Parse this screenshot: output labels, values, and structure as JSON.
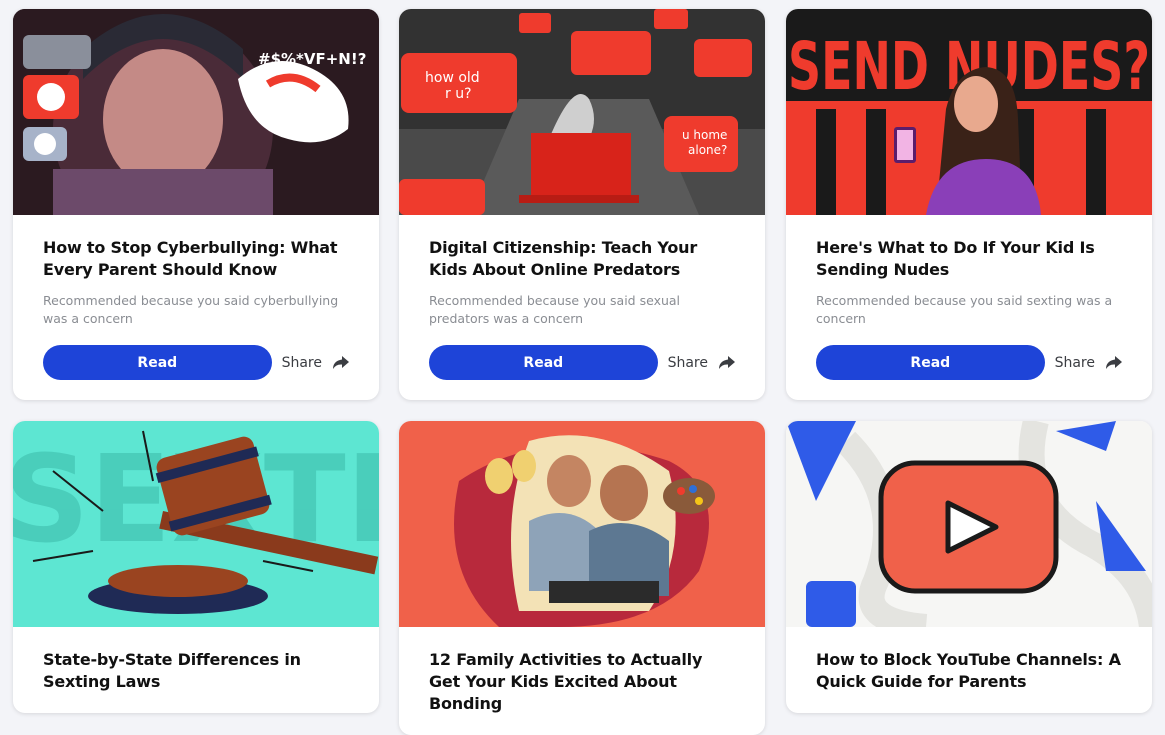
{
  "colors": {
    "accent": "#1e44d8",
    "background": "#f3f4f8",
    "brand_red": "#ef3b2d"
  },
  "cards": [
    {
      "title": "How to Stop Cyberbullying: What Every Parent Should Know",
      "reason": "Recommended because you said cyberbullying was a concern",
      "read_label": "Read",
      "share_label": "Share",
      "image_text": "#$%*VF+N!?"
    },
    {
      "title": "Digital Citizenship: Teach Your Kids About Online Predators",
      "reason": "Recommended because you said sexual predators was a concern",
      "read_label": "Read",
      "share_label": "Share",
      "image_text_1": "how old r u?",
      "image_text_2": "u home alone?"
    },
    {
      "title": "Here's What to Do If Your Kid Is Sending Nudes",
      "reason": "Recommended because you said sexting was a concern",
      "read_label": "Read",
      "share_label": "Share",
      "image_text": "SEND NUDES?"
    },
    {
      "title": "State-by-State Differences in Sexting Laws",
      "image_text": "SEXTING"
    },
    {
      "title": "12 Family Activities to Actually Get Your Kids Excited About Bonding"
    },
    {
      "title": "How to Block YouTube Channels: A Quick Guide for Parents"
    }
  ],
  "icons": {
    "share": "share-arrow-icon",
    "play": "play-icon"
  }
}
